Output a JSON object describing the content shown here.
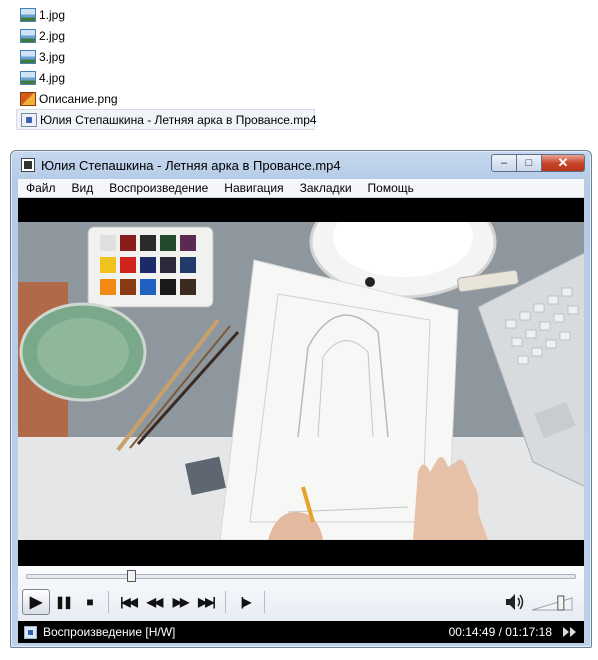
{
  "files": [
    {
      "name": "1.jpg",
      "icon": "jpg-file-icon"
    },
    {
      "name": "2.jpg",
      "icon": "jpg-file-icon"
    },
    {
      "name": "3.jpg",
      "icon": "jpg-file-icon"
    },
    {
      "name": "4.jpg",
      "icon": "jpg-file-icon"
    },
    {
      "name": "Описание.png",
      "icon": "png-file-icon"
    },
    {
      "name": "Юлия Степашкина - Летняя арка в Провансе.mp4",
      "icon": "mp4-file-icon",
      "selected": true
    }
  ],
  "window": {
    "title": "Юлия Степашкина - Летняя арка в Провансе.mp4",
    "minimize": "‒",
    "maximize": "□",
    "close": "✕"
  },
  "menu": [
    "Файл",
    "Вид",
    "Воспроизведение",
    "Навигация",
    "Закладки",
    "Помощь"
  ],
  "controls": {
    "seek_fraction": 0.189,
    "volume_fraction": 0.8,
    "play": "▶",
    "pause": "❚❚",
    "stop": "■",
    "prev": "|◀◀",
    "rewind": "◀◀",
    "forward": "▶▶",
    "next": "▶▶|",
    "frame_step": "|▶"
  },
  "status": {
    "text": "Воспроизведение [H/W]",
    "elapsed": "00:14:49",
    "total": "01:17:18",
    "time_display": "00:14:49 / 01:17:18"
  },
  "colors": {
    "accent": "#3a62b0",
    "close_button": "#c7452c",
    "title_bar": "#bcd0ea"
  }
}
